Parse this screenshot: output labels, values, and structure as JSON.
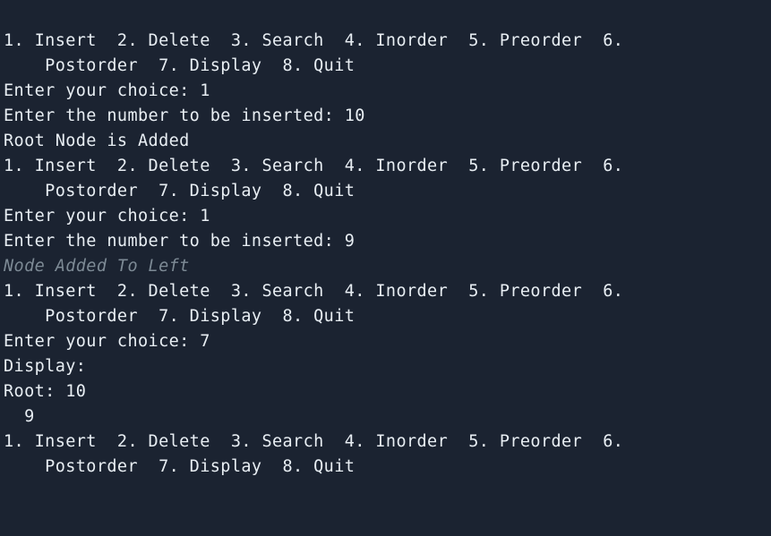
{
  "lines": [
    {
      "text": "1. Insert  2. Delete  3. Search  4. Inorder  5. Preorder  6.",
      "style": "normal"
    },
    {
      "text": "    Postorder  7. Display  8. Quit",
      "style": "normal"
    },
    {
      "text": "Enter your choice: 1",
      "style": "normal"
    },
    {
      "text": "Enter the number to be inserted: 10",
      "style": "normal"
    },
    {
      "text": "Root Node is Added",
      "style": "normal"
    },
    {
      "text": "1. Insert  2. Delete  3. Search  4. Inorder  5. Preorder  6.",
      "style": "normal"
    },
    {
      "text": "    Postorder  7. Display  8. Quit",
      "style": "normal"
    },
    {
      "text": "Enter your choice: 1",
      "style": "normal"
    },
    {
      "text": "Enter the number to be inserted: 9",
      "style": "normal"
    },
    {
      "text": "Node Added To Left",
      "style": "muted-italic"
    },
    {
      "text": "1. Insert  2. Delete  3. Search  4. Inorder  5. Preorder  6.",
      "style": "normal"
    },
    {
      "text": "    Postorder  7. Display  8. Quit",
      "style": "normal"
    },
    {
      "text": "Enter your choice: 7",
      "style": "normal"
    },
    {
      "text": "Display:",
      "style": "normal"
    },
    {
      "text": "Root: 10",
      "style": "normal"
    },
    {
      "text": "  9",
      "style": "normal"
    },
    {
      "text": "1. Insert  2. Delete  3. Search  4. Inorder  5. Preorder  6.",
      "style": "normal"
    },
    {
      "text": "    Postorder  7. Display  8. Quit",
      "style": "normal"
    }
  ]
}
